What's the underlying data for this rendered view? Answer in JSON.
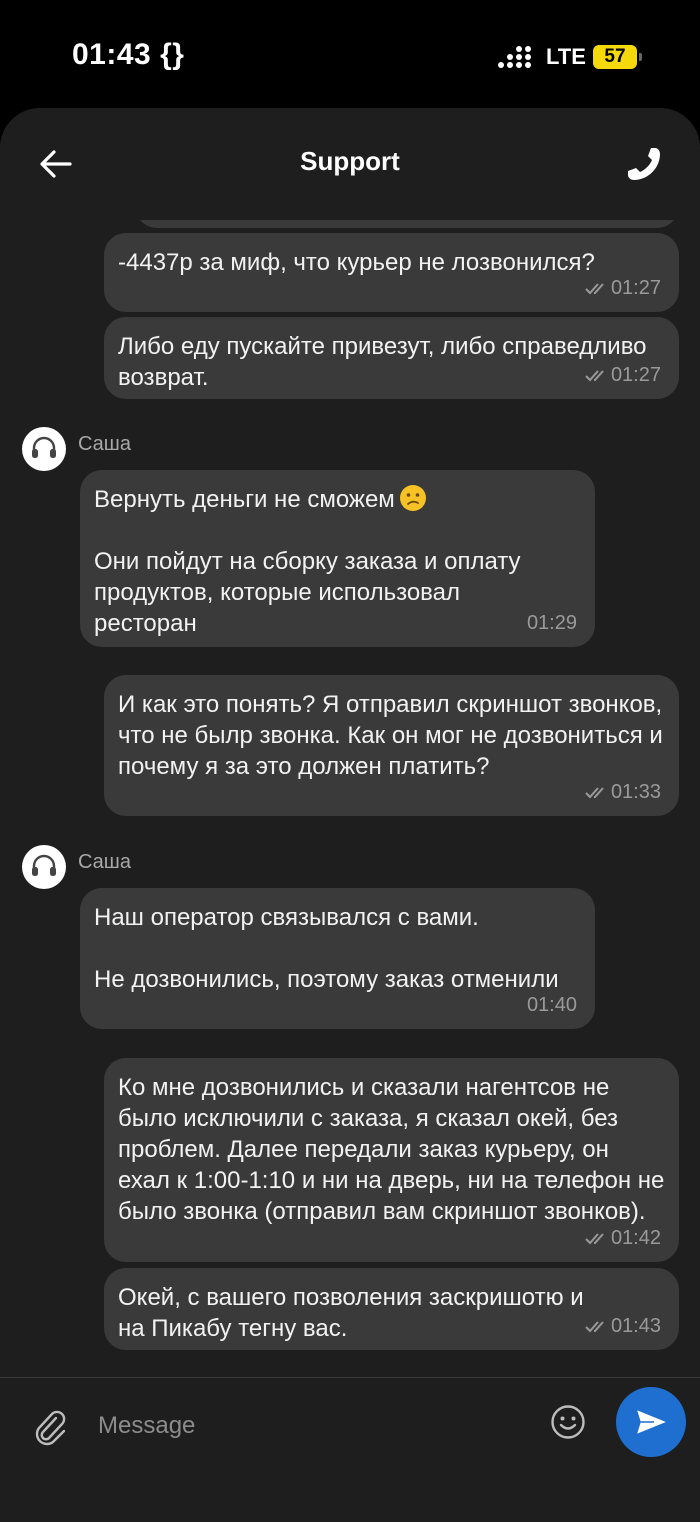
{
  "status_bar": {
    "time": "01:43 {}",
    "network": "LTE",
    "battery": "57"
  },
  "header": {
    "title": "Support",
    "back_icon": "arrow-left-icon",
    "call_icon": "phone-icon"
  },
  "messages": [
    {
      "direction": "out",
      "text": "-4437р за миф, что курьер не лозвонился?",
      "time": "01:27",
      "read": true
    },
    {
      "direction": "out",
      "text": "Либо еду пускайте привезут, либо справедливо возврат.",
      "time": "01:27",
      "read": true
    },
    {
      "direction": "in",
      "sender": "Саша",
      "text": "Вернуть деньги не сможем",
      "emoji": "confused-face",
      "text2": "Они пойдут на сборку заказа и оплату продуктов, которые использовал ресторан",
      "time": "01:29"
    },
    {
      "direction": "out",
      "text": "И как это понять? Я отправил скриншот звонков, что не былр звонка. Как он мог не дозвониться и почему я за это должен платить?",
      "time": "01:33",
      "read": true
    },
    {
      "direction": "in",
      "sender": "Саша",
      "text": "Наш оператор связывался с вами.",
      "text2": "Не дозвонились, поэтому заказ отменили",
      "time": "01:40"
    },
    {
      "direction": "out",
      "text": "Ко мне дозвонились и сказали нагентсов не было исключили с заказа, я сказал окей, без проблем. Далее передали заказ курьеру, он ехал к 1:00-1:10 и ни на дверь, ни на телефон не было звонка (отправил вам скриншот звонков).",
      "time": "01:42",
      "read": true
    },
    {
      "direction": "out",
      "text": "Окей, с вашего позволения заскришотю и на Пикабу тегну вас.",
      "time": "01:43",
      "read": true
    }
  ],
  "composer": {
    "placeholder": "Message",
    "attach_icon": "paperclip-icon",
    "emoji_icon": "smiley-icon",
    "send_icon": "send-icon"
  },
  "colors": {
    "background": "#1e1e1e",
    "bubble": "#3a3a3a",
    "accent": "#1e6fd0",
    "battery": "#f5d90a"
  }
}
